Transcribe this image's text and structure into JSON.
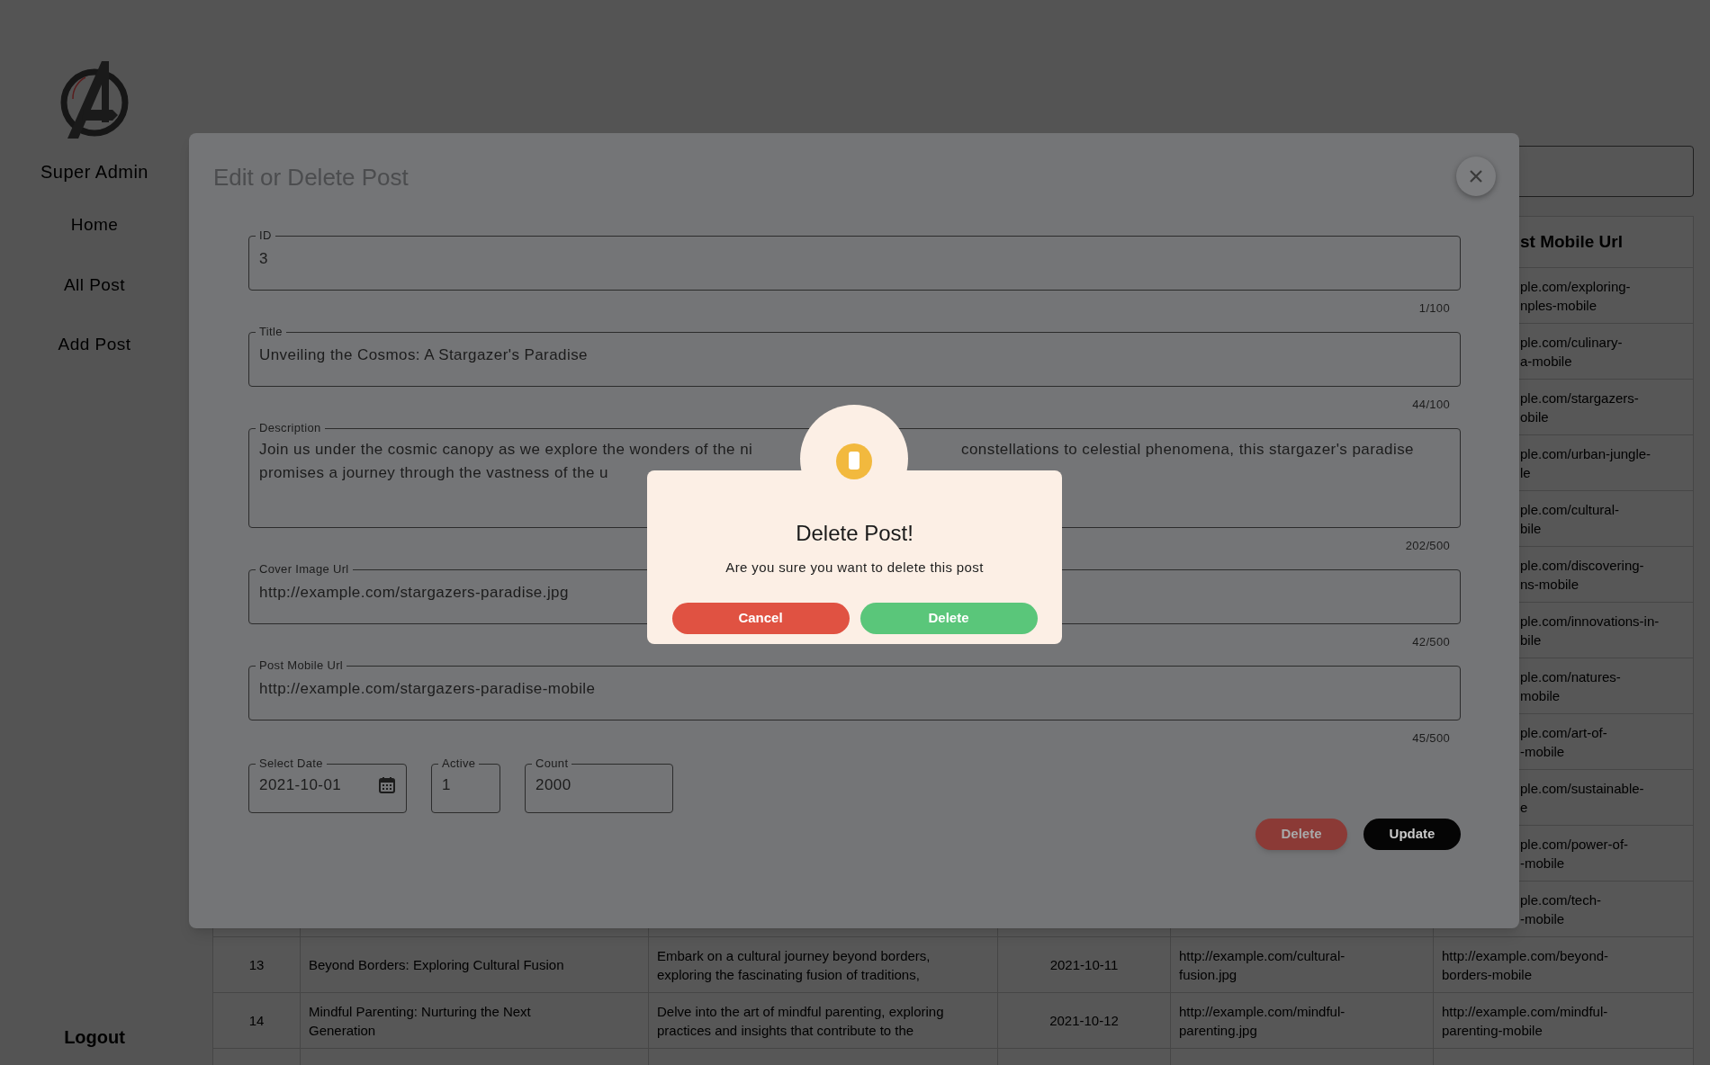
{
  "sidebar": {
    "title": "Super Admin",
    "items": [
      {
        "label": "Home"
      },
      {
        "label": "All Post"
      },
      {
        "label": "Add Post"
      }
    ],
    "logout": "Logout"
  },
  "table": {
    "header_visible": "st Mobile Url",
    "partial_cells": [
      "ple.com/exploring-\nnples-mobile",
      "ple.com/culinary-\na-mobile",
      "ple.com/stargazers-\nobile",
      "ple.com/urban-jungle-\nle",
      "ple.com/cultural-\nbile",
      "ple.com/discovering-\nns-mobile",
      "ple.com/innovations-in-\nbile",
      "ple.com/natures-\nmobile",
      "ple.com/art-of-\n-mobile",
      "ple.com/sustainable-\ne",
      "ple.com/power-of-\n-mobile",
      "ple.com/tech-\n-mobile"
    ],
    "rows": [
      {
        "cells": [
          "13",
          "Beyond Borders: Exploring Cultural Fusion",
          "Embark on a cultural journey beyond borders,\nexploring the fascinating fusion of traditions,",
          "2021-10-11",
          "http://example.com/cultural-\nfusion.jpg",
          "http://example.com/beyond-\nborders-mobile"
        ]
      },
      {
        "cells": [
          "14",
          "Mindful Parenting: Nurturing the Next\nGeneration",
          "Delve into the art of mindful parenting, exploring\npractices and insights that contribute to the",
          "2021-10-12",
          "http://example.com/mindful-\nparenting.jpg",
          "http://example.com/mindful-\nparenting-mobile"
        ]
      }
    ]
  },
  "modal": {
    "title": "Edit or Delete Post",
    "fields": [
      {
        "kind": "text",
        "label": "ID",
        "lines": [
          [
            "3"
          ]
        ],
        "counter": "1/100"
      },
      {
        "kind": "text",
        "label": "Title",
        "lines": [
          [
            "Unveiling the Cosmos: A Stargazer's Paradise"
          ]
        ],
        "counter": "44/100"
      },
      {
        "kind": "textarea",
        "label": "Description",
        "lines": [
          [
            "Join us under the cosmic canopy as we explore the wonders of the ni",
            "constellations to celestial phenomena, this stargazer's paradise"
          ],
          [
            "promises a journey through the vastness of the u"
          ]
        ],
        "counter": "202/500"
      },
      {
        "kind": "text",
        "label": "Cover Image Url",
        "lines": [
          [
            "http://example.com/stargazers-paradise.jpg"
          ]
        ],
        "counter": "42/500"
      },
      {
        "kind": "text",
        "label": "Post Mobile Url",
        "lines": [
          [
            "http://example.com/stargazers-paradise-mobile"
          ]
        ],
        "counter": "45/500"
      }
    ],
    "small_fields": [
      {
        "kind": "date",
        "label": "Select Date",
        "value": "2021-10-01"
      },
      {
        "kind": "number",
        "label": "Active",
        "value": "1"
      },
      {
        "kind": "number",
        "label": "Count",
        "value": "2000"
      }
    ],
    "buttons": [
      {
        "kind": "danger",
        "label": "Delete"
      },
      {
        "kind": "primary",
        "label": "Update"
      }
    ]
  },
  "alert": {
    "title": "Delete Post!",
    "text": "Are you sure you want to delete this post",
    "buttons": [
      {
        "kind": "cancel",
        "label": "Cancel"
      },
      {
        "kind": "confirm",
        "label": "Delete"
      }
    ]
  }
}
